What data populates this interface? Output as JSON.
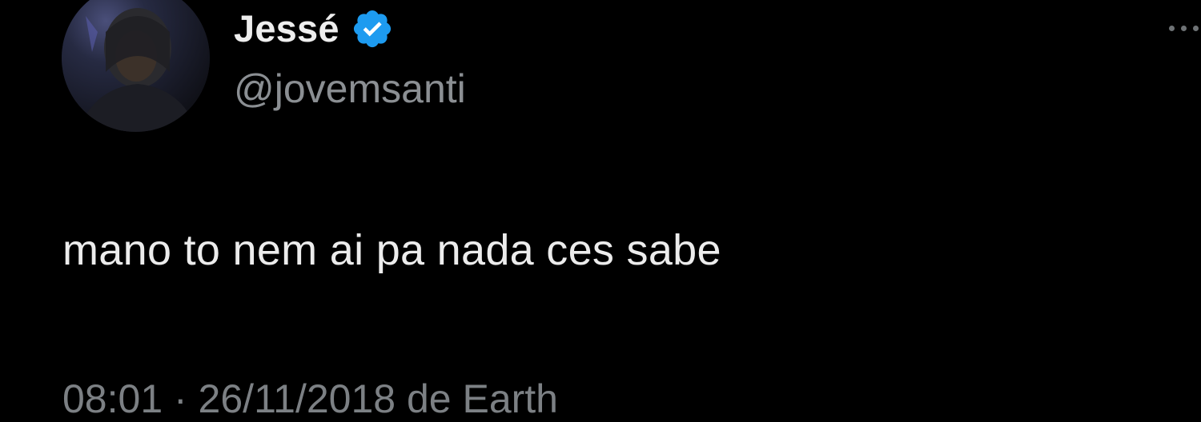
{
  "tweet": {
    "author": {
      "display_name": "Jessé",
      "handle": "@jovemsanti",
      "verified": true,
      "verified_icon": "verified-badge-icon",
      "avatar_icon": "avatar"
    },
    "text": "mano to nem ai pa nada ces sabe",
    "meta": "08:01 · 26/11/2018 de Earth",
    "more_icon": "more-options-icon"
  },
  "colors": {
    "background": "#000000",
    "text": "#e7e9ea",
    "secondary_text": "#8b8f93",
    "verified_blue": "#1d9bf0"
  }
}
